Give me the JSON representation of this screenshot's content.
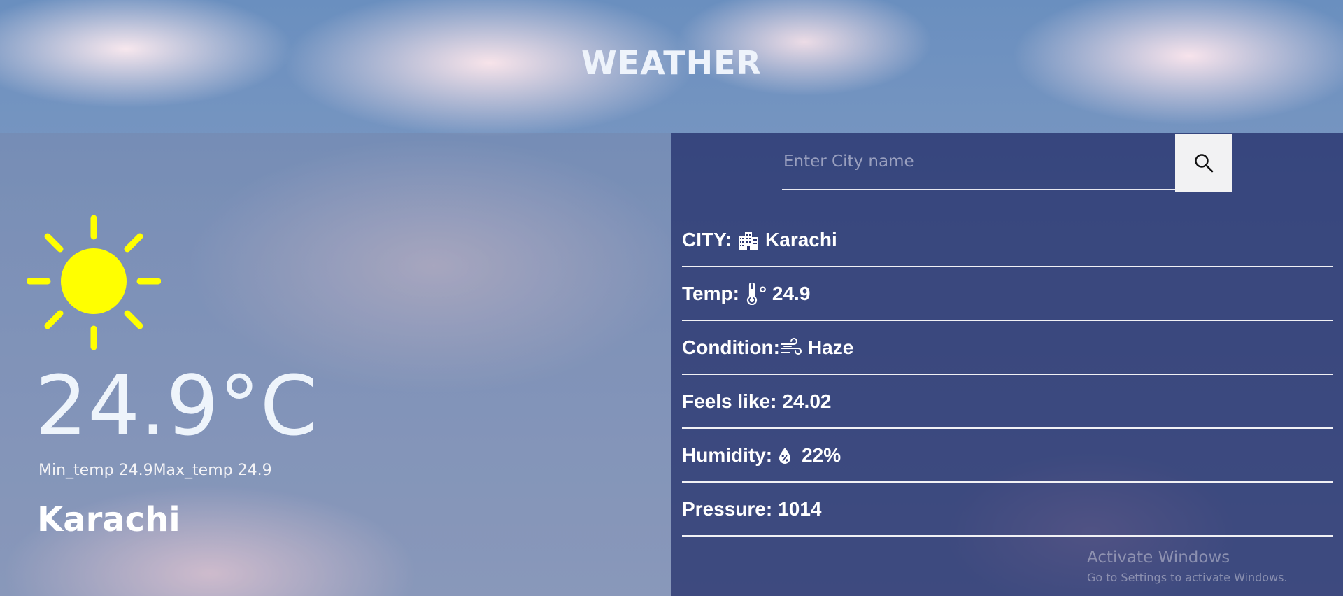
{
  "header": {
    "title": "WEATHER"
  },
  "current": {
    "temperature": "24.9°C",
    "min_max": "Min_temp 24.9Max_temp 24.9",
    "city": "Karachi",
    "icon": "sun-icon"
  },
  "search": {
    "placeholder": "Enter City name",
    "value": "",
    "button_icon": "search-icon"
  },
  "details": {
    "city_label": "CITY:",
    "city_value": "Karachi",
    "city_icon": "buildings-icon",
    "temp_label": "Temp:",
    "temp_value": "° 24.9",
    "temp_icon": "thermometer-icon",
    "condition_label": "Condition:",
    "condition_value": "Haze",
    "condition_icon": "wind-icon",
    "feels_label": "Feels like:",
    "feels_value": "24.02",
    "humidity_label": "Humidity:",
    "humidity_value": "22%",
    "humidity_icon": "humidity-drop-icon",
    "pressure_label": "Pressure:",
    "pressure_value": "1014"
  },
  "watermark": {
    "title": "Activate Windows",
    "subtitle": "Go to Settings to activate Windows."
  },
  "colors": {
    "sun": "#ffff00",
    "right_panel": "#1e2864",
    "text": "#ffffff"
  }
}
